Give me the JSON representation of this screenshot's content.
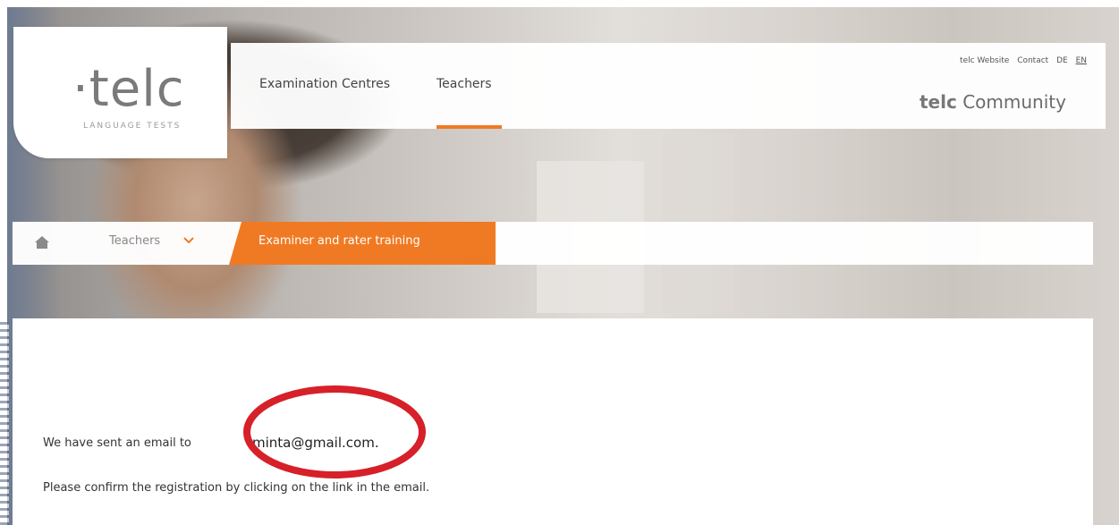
{
  "logo": {
    "mark": "·telc",
    "subtitle": "LANGUAGE TESTS"
  },
  "nav": {
    "items": [
      {
        "label": "Examination Centres"
      },
      {
        "label": "Teachers"
      }
    ]
  },
  "utility": {
    "website": "telc Website",
    "contact": "Contact",
    "lang_de": "DE",
    "lang_en": "EN"
  },
  "community": {
    "brand": "telc",
    "label": "Community"
  },
  "breadcrumb": {
    "teachers": "Teachers",
    "active": "Examiner and rater training"
  },
  "content": {
    "message_prefix": "We have sent an email to",
    "email": "minta@gmail.com.",
    "message_confirm": "Please confirm the registration by clicking on the link in the email."
  },
  "colors": {
    "accent": "#f07a23",
    "annotation": "#d6202a"
  }
}
